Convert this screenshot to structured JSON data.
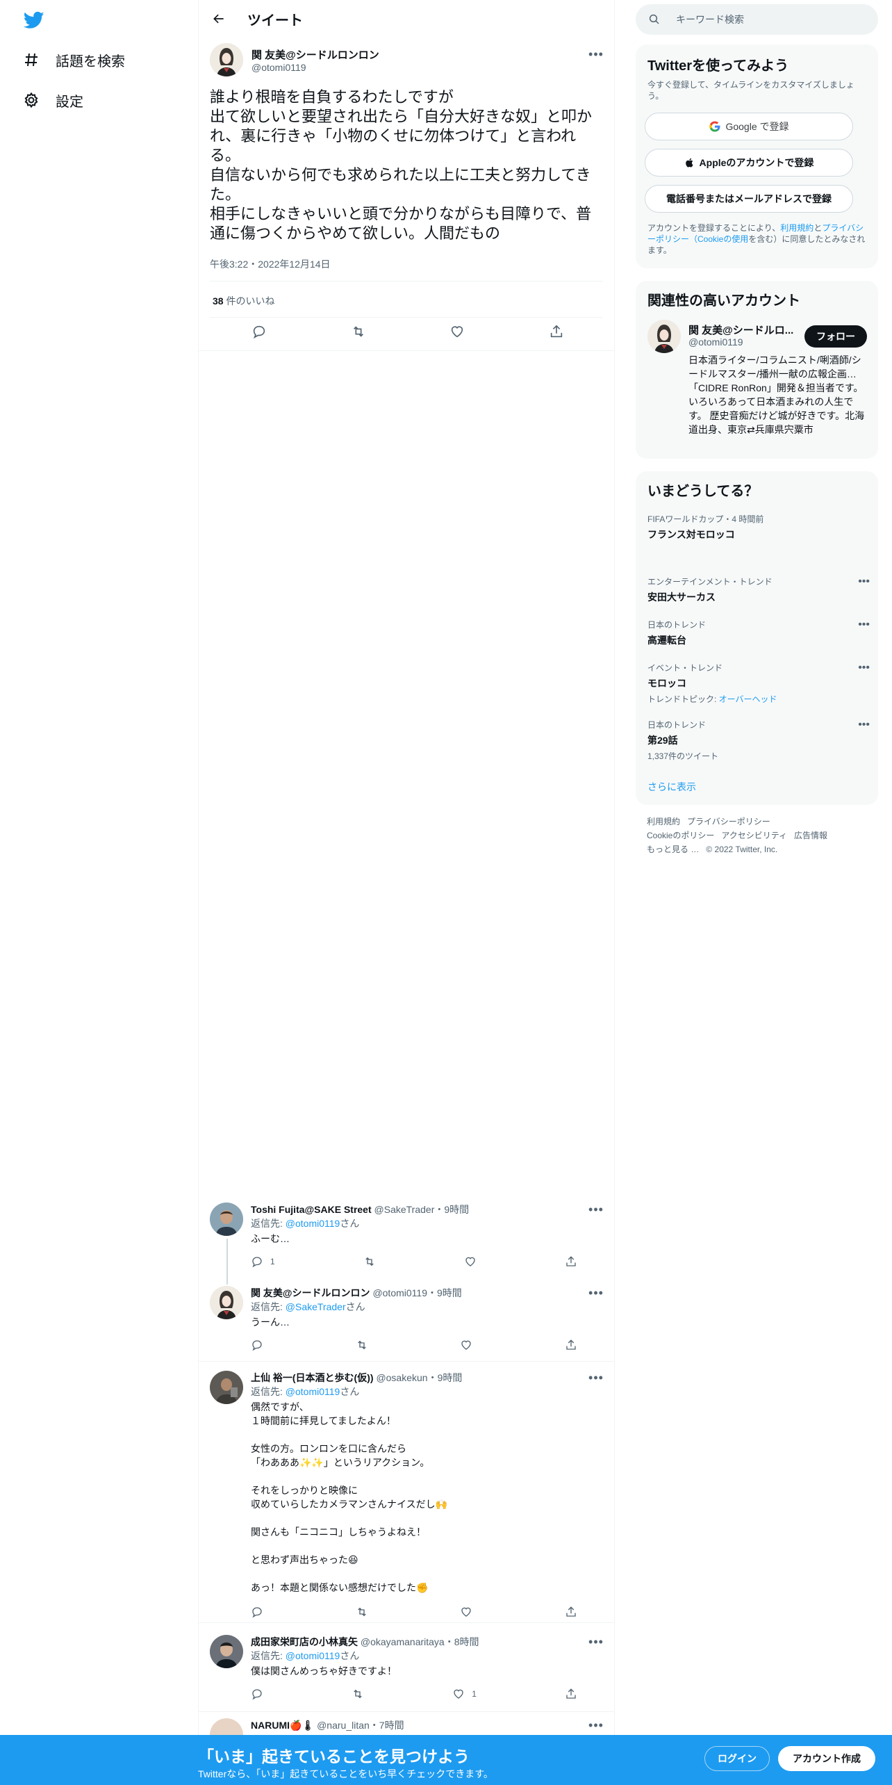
{
  "nav": {
    "explore_label": "話題を検索",
    "settings_label": "設定"
  },
  "header": {
    "title": "ツイート"
  },
  "tweet": {
    "author_name": "関 友美@シードルロンロン",
    "author_handle": "@otomi0119",
    "text": "誰より根暗を自負するわたしですが\n出て欲しいと要望され出たら「自分大好きな奴」と叩かれ、裏に行きゃ「小物のくせに勿体つけて」と言われる。\n自信ないから何でも求められた以上に工夫と努力してきた。\n相手にしなきゃいいと頭で分かりながらも目障りで、普通に傷つくからやめて欲しい。人間だもの",
    "timestamp": "午後3:22・2022年12月14日",
    "like_count": "38",
    "like_label": " 件のいいね"
  },
  "replies": [
    {
      "name": "Toshi Fujita@SAKE Street",
      "handle": "@SakeTrader",
      "time": "・9時間",
      "reply_prefix": "返信先: ",
      "reply_to": "@otomi0119",
      "reply_suffix": "さん",
      "body": "ふーむ…",
      "reply_count": "1",
      "retweet_count": "",
      "like_count": ""
    },
    {
      "name": "関 友美@シードルロンロン",
      "handle": "@otomi0119",
      "time": "・9時間",
      "reply_prefix": "返信先: ",
      "reply_to": "@SakeTrader",
      "reply_suffix": "さん",
      "body": "うーん…",
      "reply_count": "",
      "retweet_count": "",
      "like_count": ""
    },
    {
      "name": "上仙 裕一(日本酒と歩む(仮))",
      "handle": "@osakekun",
      "time": "・9時間",
      "reply_prefix": "返信先: ",
      "reply_to": "@otomi0119",
      "reply_suffix": "さん",
      "body": "偶然ですが、\n１時間前に拝見してましたよん！\n\n女性の方。ロンロンを口に含んだら\n「わあああ✨✨」というリアクション。\n\nそれをしっかりと映像に\n収めていらしたカメラマンさんナイスだし🙌\n\n関さんも「ニコニコ」しちゃうよねえ！\n\nと思わず声出ちゃった😆\n\nあっ！本題と関係ない感想だけでした✊",
      "reply_count": "",
      "retweet_count": "",
      "like_count": ""
    },
    {
      "name": "成田家栄町店の小林真矢",
      "handle": "@okayamanaritaya",
      "time": "・8時間",
      "reply_prefix": "返信先: ",
      "reply_to": "@otomi0119",
      "reply_suffix": "さん",
      "body": "僕は関さんめっちゃ好きですよ！",
      "reply_count": "",
      "retweet_count": "",
      "like_count": "1"
    },
    {
      "name": "NARUMI🍎🌡",
      "handle": "@naru_litan",
      "time": "・7時間"
    }
  ],
  "search": {
    "placeholder": "キーワード検索"
  },
  "signup_card": {
    "title": "Twitterを使ってみよう",
    "subtitle": "今すぐ登録して、タイムラインをカスタマイズしましょう。",
    "google_label": "Google で登録",
    "apple_label": "Appleのアカウントで登録",
    "phone_label": "電話番号またはメールアドレスで登録",
    "terms_prefix": "アカウントを登録することにより、",
    "terms_link": "利用規約",
    "terms_and": "と",
    "privacy_link": "プライバシーポリシー（Cookieの使用",
    "terms_suffix": "を含む）に同意したとみなされます。"
  },
  "related": {
    "title": "関連性の高いアカウント",
    "name": "関 友美@シードルロ...",
    "handle": "@otomi0119",
    "follow_label": "フォロー",
    "bio": "日本酒ライター/コラムニスト/唎酒師/シードルマスター/播州一献の広報企画…「CIDRE RonRon」開発＆担当者です。いろいろあって日本酒まみれの人生です。 歴史音痴だけど城が好きです。北海道出身、東京⇄兵庫県宍粟市"
  },
  "trends": {
    "title": "いまどうしてる？",
    "items": [
      {
        "category": "FIFAワールドカップ・4 時間前",
        "name": "フランス対モロッコ",
        "sub": "",
        "sub_link": ""
      },
      {
        "category": "エンターテインメント・トレンド",
        "name": "安田大サーカス",
        "sub": "",
        "sub_link": ""
      },
      {
        "category": "日本のトレンド",
        "name": "高遷転台",
        "sub": "",
        "sub_link": ""
      },
      {
        "category": "イベント・トレンド",
        "name": "モロッコ",
        "sub": "トレンドトピック: ",
        "sub_link": "オーバーヘッド"
      },
      {
        "category": "日本のトレンド",
        "name": "第29話",
        "sub": "1,337件のツイート",
        "sub_link": ""
      }
    ],
    "show_more": "さらに表示"
  },
  "footer": {
    "terms": "利用規約",
    "privacy": "プライバシーポリシー",
    "cookies": "Cookieのポリシー",
    "accessibility": "アクセシビリティ",
    "ads": "広告情報",
    "more": "もっと見る …",
    "copyright": "© 2022 Twitter, Inc."
  },
  "banner": {
    "title": "「いま」起きていることを見つけよう",
    "subtitle": "Twitterなら、「いま」起きていることをいち早くチェックできます。",
    "login_label": "ログイン",
    "signup_label": "アカウント作成"
  },
  "colors": {
    "brand": "#1d9bf0",
    "text": "#0f1419",
    "secondary": "#536471"
  }
}
